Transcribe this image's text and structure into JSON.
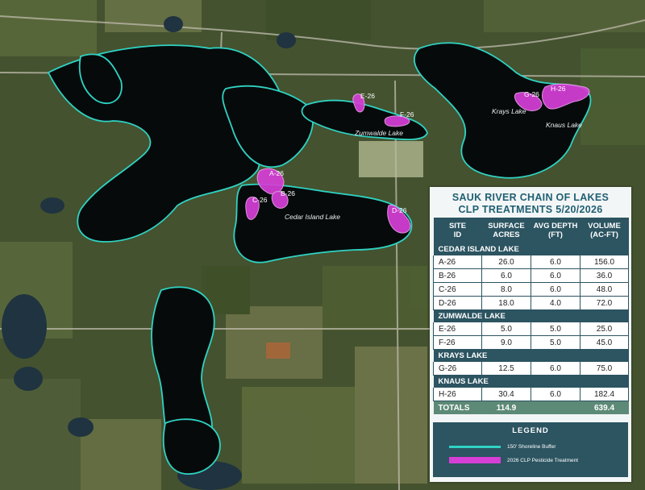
{
  "map": {
    "lake_labels": {
      "cedar_island": "Cedar Island Lake",
      "zumwalde": "Zumwalde Lake",
      "krays": "Krays Lake",
      "knaus": "Knaus Lake"
    },
    "sites": [
      "A-26",
      "B-26",
      "C-26",
      "D-26",
      "E-26",
      "F-26",
      "G-26",
      "H-26"
    ],
    "colors": {
      "buffer": "#2fd3c3",
      "treatment": "#d63fd6",
      "lake": "#070a0b"
    }
  },
  "panel": {
    "title_line1": "SAUK RIVER CHAIN OF LAKES",
    "title_line2": "CLP TREATMENTS 5/20/2026",
    "headers": [
      [
        "SITE",
        "ID"
      ],
      [
        "SURFACE",
        "ACRES"
      ],
      [
        "AVG DEPTH",
        "(FT)"
      ],
      [
        "VOLUME",
        "(AC-FT)"
      ]
    ],
    "groups": [
      {
        "name": "CEDAR ISLAND LAKE",
        "rows": [
          {
            "id": "A-26",
            "acres": "26.0",
            "depth": "6.0",
            "volume": "156.0"
          },
          {
            "id": "B-26",
            "acres": "6.0",
            "depth": "6.0",
            "volume": "36.0"
          },
          {
            "id": "C-26",
            "acres": "8.0",
            "depth": "6.0",
            "volume": "48.0"
          },
          {
            "id": "D-26",
            "acres": "18.0",
            "depth": "4.0",
            "volume": "72.0"
          }
        ]
      },
      {
        "name": "ZUMWALDE LAKE",
        "rows": [
          {
            "id": "E-26",
            "acres": "5.0",
            "depth": "5.0",
            "volume": "25.0"
          },
          {
            "id": "F-26",
            "acres": "9.0",
            "depth": "5.0",
            "volume": "45.0"
          }
        ]
      },
      {
        "name": "KRAYS LAKE",
        "rows": [
          {
            "id": "G-26",
            "acres": "12.5",
            "depth": "6.0",
            "volume": "75.0"
          }
        ]
      },
      {
        "name": "KNAUS LAKE",
        "rows": [
          {
            "id": "H-26",
            "acres": "30.4",
            "depth": "6.0",
            "volume": "182.4"
          }
        ]
      }
    ],
    "totals": {
      "label": "TOTALS",
      "acres": "114.9",
      "depth": "",
      "volume": "639.4"
    },
    "legend": {
      "title": "LEGEND",
      "buffer_label": "150' Shoreline Buffer",
      "treatment_label": "2026 CLP Pesticide Treatment"
    }
  }
}
